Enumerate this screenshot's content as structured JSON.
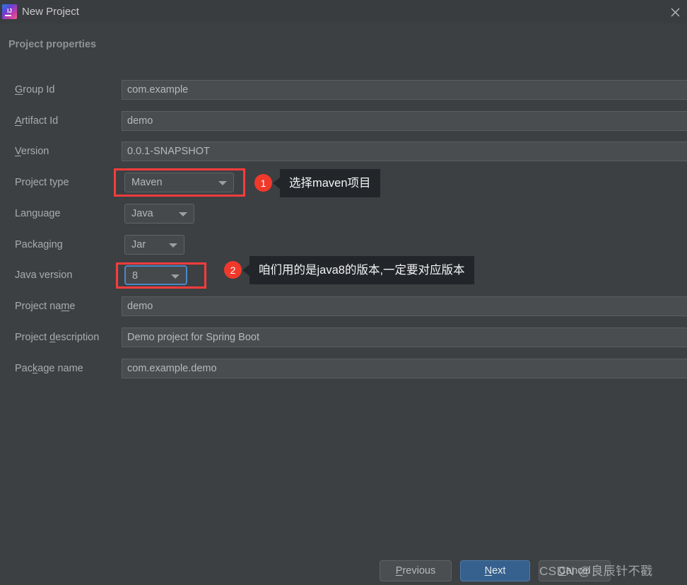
{
  "window": {
    "title": "New Project",
    "logo_icon": "intellij-idea-logo",
    "logo_glyph": "IJ",
    "close_icon": "close-icon"
  },
  "section": {
    "heading": "Project properties"
  },
  "form": {
    "fields": [
      {
        "label_pre": "",
        "label_mnemonic": "G",
        "label_post": "roup Id",
        "value": "com.example",
        "type": "text"
      },
      {
        "label_pre": "",
        "label_mnemonic": "A",
        "label_post": "rtifact Id",
        "value": "demo",
        "type": "text"
      },
      {
        "label_pre": "",
        "label_mnemonic": "V",
        "label_post": "ersion",
        "value": "0.0.1-SNAPSHOT",
        "type": "text"
      },
      {
        "label_pre": "Project type",
        "label_mnemonic": "",
        "label_post": "",
        "value": "Maven",
        "type": "combo"
      },
      {
        "label_pre": "Language",
        "label_mnemonic": "",
        "label_post": "",
        "value": "Java",
        "type": "combo"
      },
      {
        "label_pre": "Packaging",
        "label_mnemonic": "",
        "label_post": "",
        "value": "Jar",
        "type": "combo"
      },
      {
        "label_pre": "Java version",
        "label_mnemonic": "",
        "label_post": "",
        "value": "8",
        "type": "combo"
      },
      {
        "label_pre": "Project na",
        "label_mnemonic": "m",
        "label_post": "e",
        "value": "demo",
        "type": "text"
      },
      {
        "label_pre": "Project ",
        "label_mnemonic": "d",
        "label_post": "escription",
        "value": "Demo project for Spring Boot",
        "type": "text"
      },
      {
        "label_pre": "Pac",
        "label_mnemonic": "k",
        "label_post": "age name",
        "value": "com.example.demo",
        "type": "text"
      }
    ]
  },
  "annotations": {
    "accent_color": "#f0392b",
    "items": [
      {
        "badge": "1",
        "text": "选择maven项目"
      },
      {
        "badge": "2",
        "text": "咱们用的是java8的版本,一定要对应版本"
      }
    ]
  },
  "footer": {
    "previous": {
      "pre": "",
      "mnemonic": "P",
      "post": "revious"
    },
    "next": {
      "pre": "",
      "mnemonic": "N",
      "post": "ext"
    },
    "cancel": {
      "pre": "",
      "mnemonic": "C",
      "post": "ancel"
    }
  },
  "watermark": {
    "text": "CSDN @良辰针不戳"
  }
}
